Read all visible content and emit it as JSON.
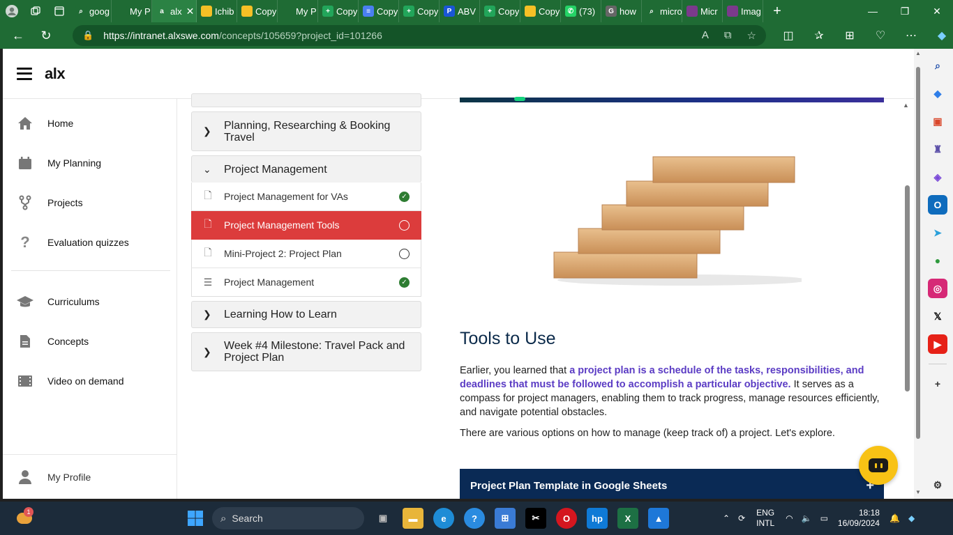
{
  "tabs": [
    {
      "label": "goog",
      "fav_color": "#1f6b34",
      "fav_glyph": "⌕"
    },
    {
      "label": "My P",
      "fav_color": "#1f6b34",
      "fav_glyph": ""
    },
    {
      "label": "alx",
      "fav_color": "#2b8244",
      "fav_glyph": "a",
      "active": true
    },
    {
      "label": "Ichib",
      "fav_color": "#f6c026",
      "fav_glyph": ""
    },
    {
      "label": "Copy",
      "fav_color": "#f6c026",
      "fav_glyph": ""
    },
    {
      "label": "My P",
      "fav_color": "#1f6b34",
      "fav_glyph": ""
    },
    {
      "label": "Copy",
      "fav_color": "#22a55a",
      "fav_glyph": "+"
    },
    {
      "label": "Copy",
      "fav_color": "#4a7ff0",
      "fav_glyph": "≡"
    },
    {
      "label": "Copy",
      "fav_color": "#22a55a",
      "fav_glyph": "+"
    },
    {
      "label": "ABV",
      "fav_color": "#1a56d6",
      "fav_glyph": "P"
    },
    {
      "label": "Copy",
      "fav_color": "#22a55a",
      "fav_glyph": "+"
    },
    {
      "label": "Copy",
      "fav_color": "#f6c026",
      "fav_glyph": ""
    },
    {
      "label": "(73)",
      "fav_color": "#25d366",
      "fav_glyph": "✆"
    },
    {
      "label": "how",
      "fav_color": "#666666",
      "fav_glyph": "G"
    },
    {
      "label": "micro",
      "fav_color": "#1f6b34",
      "fav_glyph": "⌕"
    },
    {
      "label": "Micr",
      "fav_color": "#7b3a8c",
      "fav_glyph": ""
    },
    {
      "label": "Imag",
      "fav_color": "#7b3a8c",
      "fav_glyph": ""
    }
  ],
  "url": {
    "host": "https://intranet.alxswe.com",
    "path": "/concepts/105659?project_id=101266"
  },
  "site": {
    "logo": "alx"
  },
  "nav": {
    "items": [
      {
        "label": "Home",
        "icon": "home-icon"
      },
      {
        "label": "My Planning",
        "icon": "calendar-icon"
      },
      {
        "label": "Projects",
        "icon": "fork-icon"
      },
      {
        "label": "Evaluation quizzes",
        "icon": "question-icon"
      },
      {
        "label": "Curriculums",
        "icon": "graduation-cap-icon"
      },
      {
        "label": "Concepts",
        "icon": "document-icon"
      },
      {
        "label": "Video on demand",
        "icon": "film-icon"
      }
    ],
    "profile": "My Profile"
  },
  "curriculum": {
    "sections": [
      {
        "title": "Planning, Researching & Booking Travel",
        "expanded": false
      },
      {
        "title": "Project Management",
        "expanded": true
      },
      {
        "title": "Learning How to Learn",
        "expanded": false
      },
      {
        "title": "Week #4 Milestone: Travel Pack and Project Plan",
        "expanded": false
      }
    ],
    "lessons": [
      {
        "title": "Project Management for VAs",
        "status": "done",
        "icon": "page-icon"
      },
      {
        "title": "Project Management Tools",
        "status": "open",
        "icon": "page-icon",
        "active": true
      },
      {
        "title": "Mini-Project 2: Project Plan",
        "status": "open",
        "icon": "page-icon"
      },
      {
        "title": "Project Management",
        "status": "done",
        "icon": "checklist-icon"
      }
    ]
  },
  "content": {
    "heading": "Tools to Use",
    "para_intro": "Earlier, you learned that ",
    "para_bold": "a project plan is a schedule of the tasks, responsibilities, and deadlines that must be followed to accomplish a particular objective.",
    "para_rest": " It serves as a compass for project managers, enabling them to track progress, manage resources efficiently, and navigate potential obstacles.",
    "para2": "There are various options on how to manage (keep track of) a project. Let's explore.",
    "accordion_title": "Project Plan Template in Google Sheets",
    "accordion_icon": "+"
  },
  "taskbar": {
    "search": "Search",
    "weather_badge": "1",
    "lang_top": "ENG",
    "lang_bottom": "INTL",
    "time": "18:18",
    "date": "16/09/2024"
  },
  "colors": {
    "browser_chrome": "#1f6b34",
    "active_lesson": "#dc3c3c",
    "done_check": "#2e7d32",
    "accent_purple": "#5b3cc4",
    "accordion": "#0a2a55",
    "chat_button": "#f8c215"
  }
}
